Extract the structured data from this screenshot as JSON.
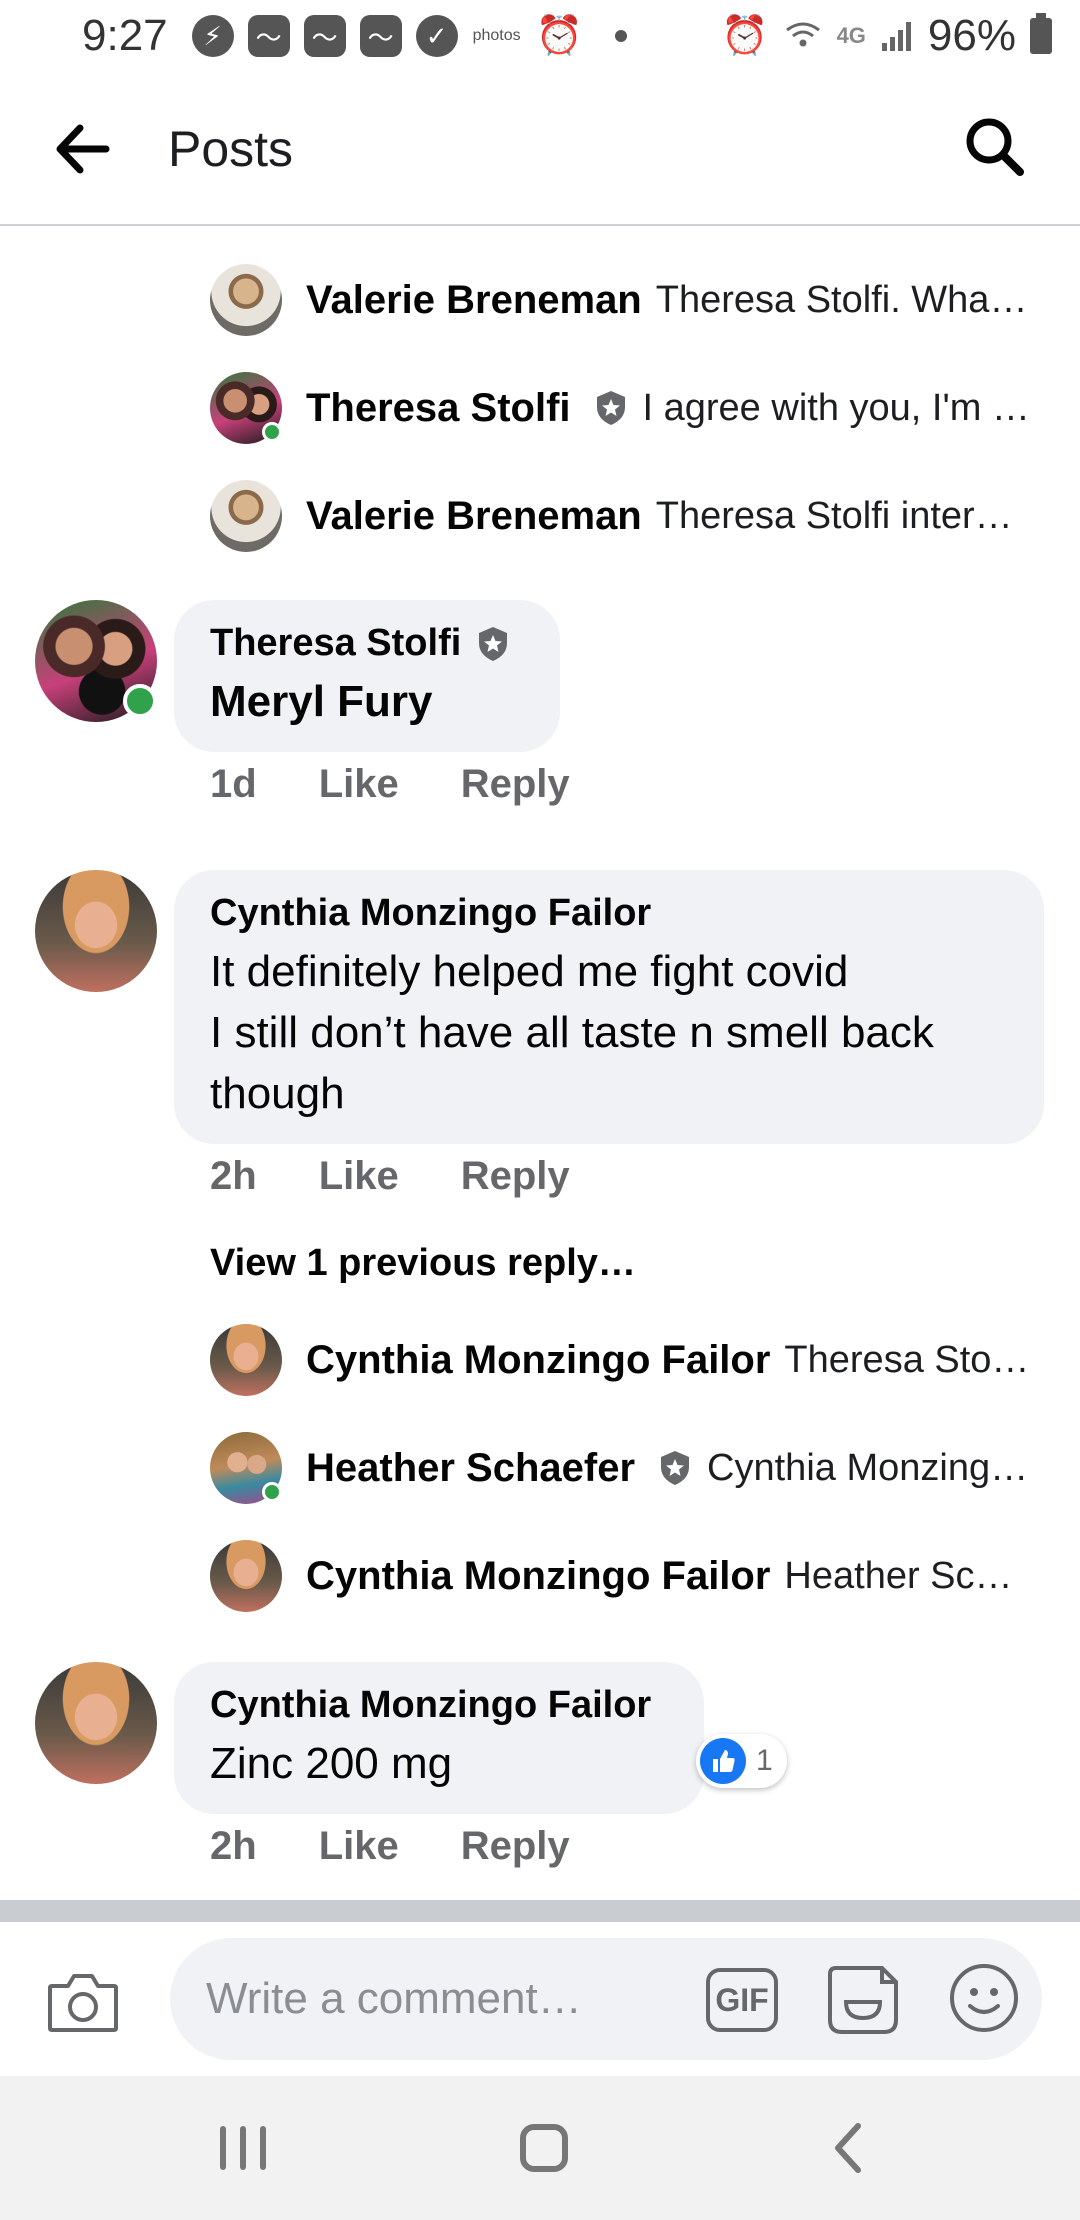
{
  "status_bar": {
    "time": "9:27",
    "photos_label": "photos",
    "network": "4G",
    "battery": "96%",
    "icons": [
      "messenger-icon",
      "news-icon",
      "news-icon",
      "news-icon",
      "check-icon",
      "amazon-photos-icon",
      "alarm-icon",
      "dot-icon",
      "alarm-icon",
      "wifi-icon",
      "signal-icon",
      "battery-icon"
    ]
  },
  "header": {
    "title": "Posts",
    "back_icon": "arrow-left-icon",
    "search_icon": "search-icon"
  },
  "top_replies": [
    {
      "name": "Valerie Breneman",
      "text": "Theresa Stolfi. What…",
      "online": false,
      "badge": false
    },
    {
      "name": "Theresa Stolfi",
      "text": "I agree with you, I'm …",
      "online": true,
      "badge": true
    },
    {
      "name": "Valerie Breneman",
      "text": "Theresa Stolfi intere…",
      "online": false,
      "badge": false
    }
  ],
  "comments": [
    {
      "name": "Theresa Stolfi",
      "text": "Meryl Fury",
      "badge": true,
      "online": true,
      "age": "1d",
      "like": "Like",
      "reply": "Reply"
    },
    {
      "name": "Cynthia Monzingo Failor",
      "text_lines": [
        "It definitely helped me fight covid",
        "I still don’t have all taste n smell back",
        "though"
      ],
      "age": "2h",
      "like": "Like",
      "reply": "Reply",
      "view_previous": "View 1 previous reply…",
      "replies": [
        {
          "name": "Cynthia Monzingo Failor",
          "text": "Theresa Stol…",
          "online": false,
          "badge": false
        },
        {
          "name": "Heather Schaefer",
          "text": "Cynthia Monzing…",
          "online": true,
          "badge": true
        },
        {
          "name": "Cynthia Monzingo Failor",
          "text": "Heather Sch…",
          "online": false,
          "badge": false
        }
      ]
    },
    {
      "name": "Cynthia Monzingo Failor",
      "text": "Zinc 200 mg",
      "reaction_count": "1",
      "age": "2h",
      "like": "Like",
      "reply": "Reply"
    }
  ],
  "composer": {
    "placeholder": "Write a comment…",
    "gif_label": "GIF",
    "camera_icon": "camera-icon",
    "sticker_icon": "sticker-icon",
    "emoji_icon": "emoji-icon"
  },
  "colors": {
    "accent": "#1877f2",
    "bubble": "#f0f2f5",
    "online": "#31a24c",
    "meta_text": "#65676b"
  }
}
